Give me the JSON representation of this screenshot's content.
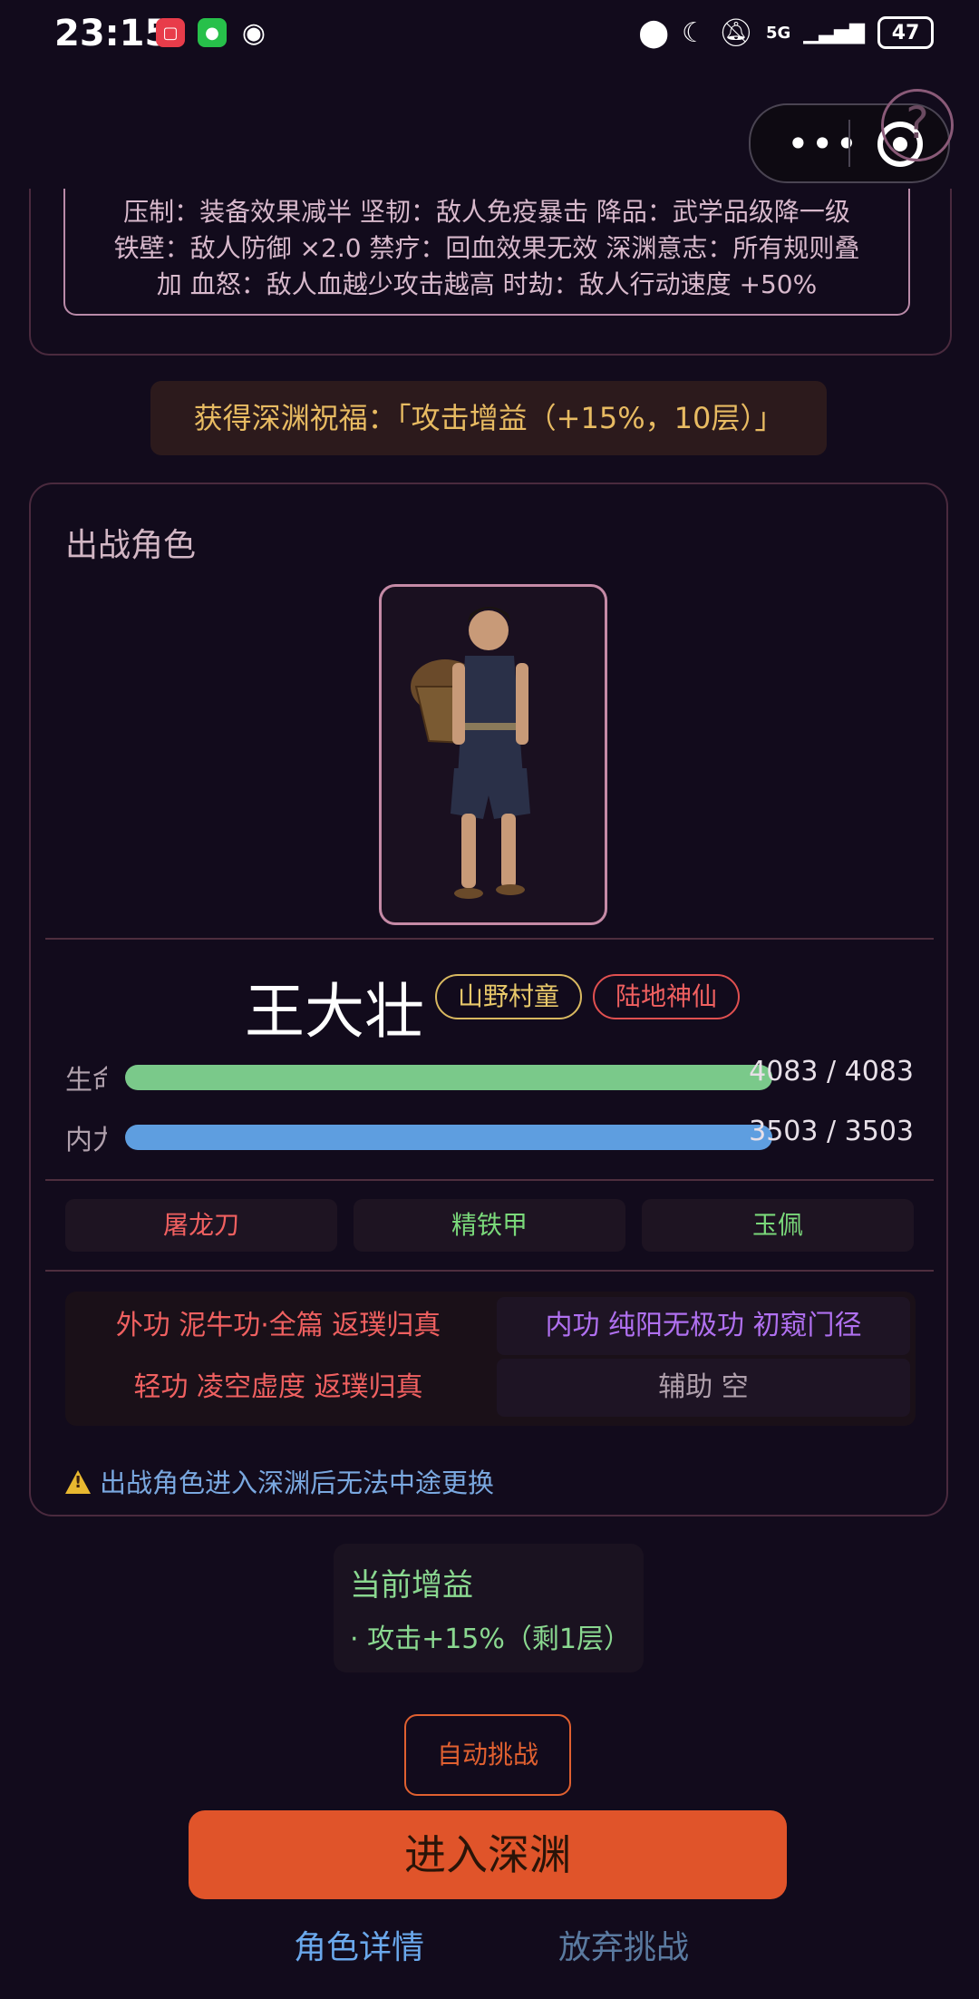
{
  "status_bar": {
    "time": "23:15",
    "network": "5G",
    "battery": "47",
    "icons": [
      "store-app-icon",
      "wechat-icon",
      "eye-icon",
      "location-icon",
      "moon-icon",
      "mute-icon",
      "signal-icon"
    ]
  },
  "capsule": {
    "more_label": "•••"
  },
  "help": {
    "label": "?"
  },
  "rules": {
    "lines": [
      "压制：装备效果减半  坚韧：敌人免疫暴击  降品：武学品级降一级",
      "铁壁：敌人防御 ×2.0  禁疗：回血效果无效  深渊意志：所有规则叠",
      "加  血怒：敌人血越少攻击越高  时劫：敌人行动速度 +50%"
    ]
  },
  "blessing": "获得深渊祝福：「攻击增益（+15%，10层）」",
  "card": {
    "title": "出战角色",
    "character": {
      "name": "王大壮",
      "tags": [
        "山野村童",
        "陆地神仙"
      ]
    },
    "stats": [
      {
        "label": "生命",
        "current": 4083,
        "max": 4083,
        "display": "4083 / 4083",
        "fraction": 1.0,
        "color": "#7ac98a"
      },
      {
        "label": "内力",
        "current": 3503,
        "max": 3503,
        "display": "3503 / 3503",
        "fraction": 1.0,
        "color": "#5e9ee0"
      }
    ],
    "equipment": [
      {
        "name": "屠龙刀",
        "color": "#f06060"
      },
      {
        "name": "精铁甲",
        "color": "#7ad87a"
      },
      {
        "name": "玉佩",
        "color": "#7ad87a"
      }
    ],
    "skills": [
      {
        "text": "外功  泥牛功·全篇  返璞归真",
        "color": "#f06060"
      },
      {
        "text": "内功  纯阳无极功  初窥门径",
        "color": "#b070f0"
      },
      {
        "text": "轻功  凌空虚度  返璞归真",
        "color": "#f06060"
      },
      {
        "text": "辅助  空",
        "color": "#b0a0ac"
      }
    ],
    "warning": "出战角色进入深渊后无法中途更换"
  },
  "buff": {
    "title": "当前增益",
    "items": [
      "· 攻击+15%（剩1层）"
    ]
  },
  "buttons": {
    "auto": "自动挑战",
    "enter": "进入深渊",
    "details": "角色详情",
    "abandon": "放弃挑战"
  }
}
